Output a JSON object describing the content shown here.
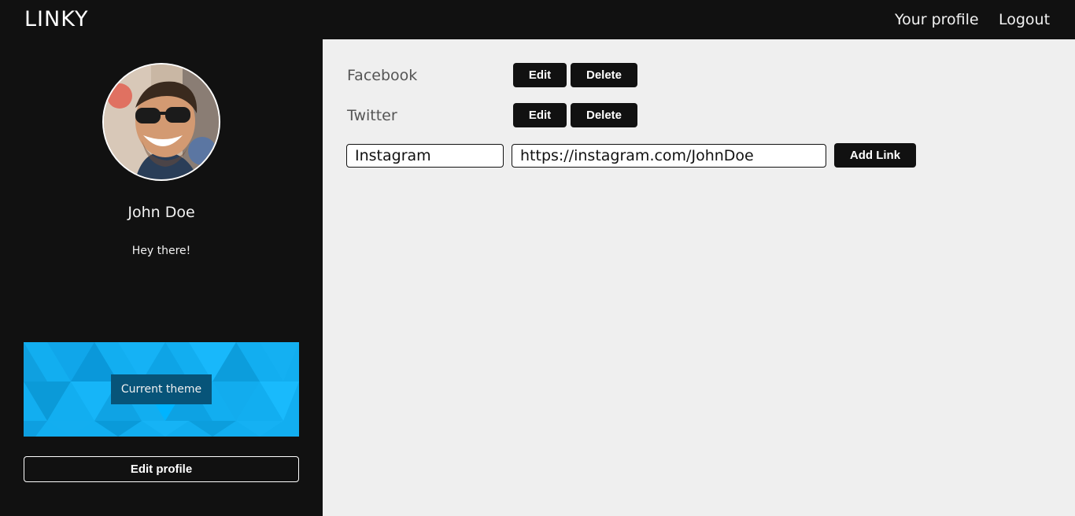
{
  "app": {
    "brand": "LINKY"
  },
  "nav": {
    "profile_label": "Your profile",
    "logout_label": "Logout"
  },
  "profile": {
    "name": "John Doe",
    "bio": "Hey there!",
    "theme_label": "Current theme",
    "edit_label": "Edit profile"
  },
  "links": [
    {
      "name": "Facebook",
      "edit_label": "Edit",
      "delete_label": "Delete"
    },
    {
      "name": "Twitter",
      "edit_label": "Edit",
      "delete_label": "Delete"
    }
  ],
  "new_link": {
    "name_value": "Instagram",
    "url_value": "https://instagram.com/JohnDoe",
    "add_label": "Add Link"
  },
  "colors": {
    "topbar": "#111111",
    "sidebar": "#111111",
    "main_background": "#efefef",
    "button": "#111111",
    "theme_accent": "#12aef0"
  },
  "icons": {
    "avatar": "user-photo"
  }
}
